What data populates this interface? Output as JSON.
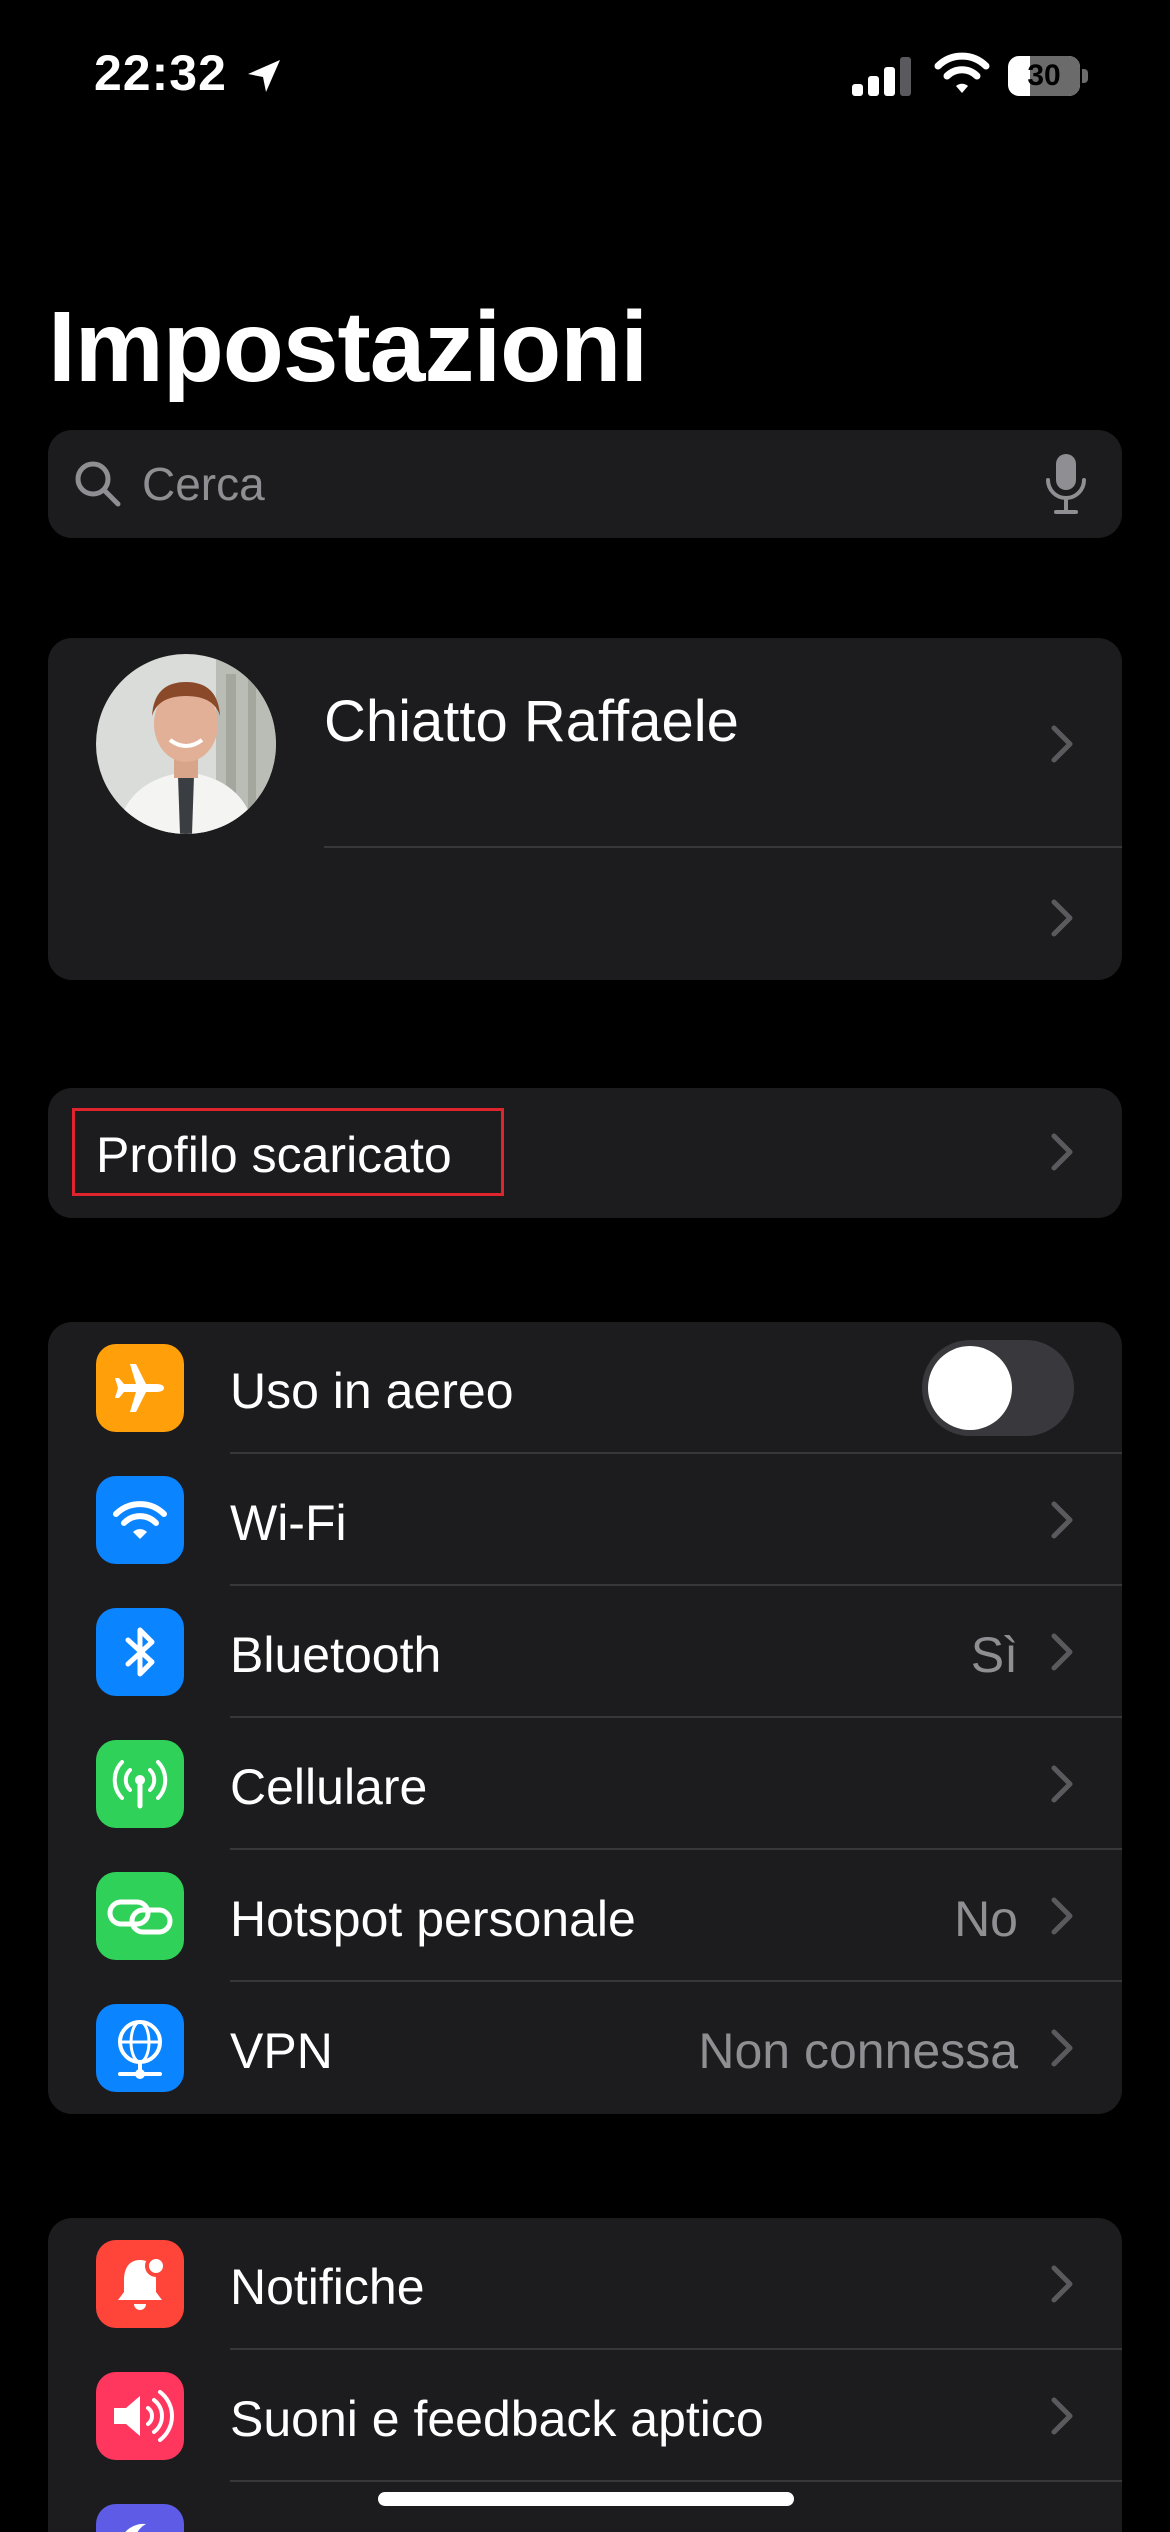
{
  "status_bar": {
    "time": "22:32",
    "battery_level": "30",
    "battery_fraction": 0.3,
    "icons": [
      "location-arrow-icon",
      "cellular-signal-icon",
      "wifi-icon",
      "battery-icon"
    ]
  },
  "header": {
    "title": "Impostazioni"
  },
  "search": {
    "placeholder": "Cerca",
    "value": ""
  },
  "profile": {
    "name": "Chiatto Raffaele"
  },
  "downloaded_profile": {
    "label": "Profilo scaricato",
    "highlight_color": "#e0242d"
  },
  "connectivity": {
    "items": [
      {
        "label": "Uso in aereo",
        "value": "",
        "icon": "airplane-icon",
        "color": "#ff9f0a",
        "toggle": false
      },
      {
        "label": "Wi-Fi",
        "value": "",
        "icon": "wifi-icon",
        "color": "#0a84ff"
      },
      {
        "label": "Bluetooth",
        "value": "Sì",
        "icon": "bluetooth-icon",
        "color": "#0a84ff"
      },
      {
        "label": "Cellulare",
        "value": "",
        "icon": "antenna-icon",
        "color": "#30d158"
      },
      {
        "label": "Hotspot personale",
        "value": "No",
        "icon": "hotspot-link-icon",
        "color": "#30d158"
      },
      {
        "label": "VPN",
        "value": "Non connessa",
        "icon": "globe-network-icon",
        "color": "#0a84ff"
      }
    ]
  },
  "notifications_group": {
    "items": [
      {
        "label": "Notifiche",
        "icon": "bell-icon",
        "color": "#ff453a"
      },
      {
        "label": "Suoni e feedback aptico",
        "icon": "speaker-icon",
        "color": "#ff375f"
      },
      {
        "label": "",
        "icon": "moon-icon",
        "color": "#5e5ce6"
      }
    ]
  }
}
